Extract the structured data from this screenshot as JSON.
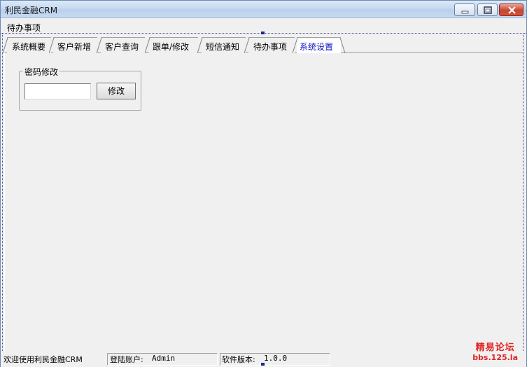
{
  "window": {
    "title": "利民金融CRM"
  },
  "menu": {
    "items": [
      {
        "label": "待办事项"
      }
    ]
  },
  "tabs": [
    {
      "label": "系统概要",
      "active": false
    },
    {
      "label": "客户新增",
      "active": false
    },
    {
      "label": "客户查询",
      "active": false
    },
    {
      "label": "跟单/修改",
      "active": false
    },
    {
      "label": "短信通知",
      "active": false
    },
    {
      "label": "待办事项",
      "active": false
    },
    {
      "label": "系统设置",
      "active": true
    }
  ],
  "password_group": {
    "title": "密码修改",
    "input_value": "",
    "button_label": "修改"
  },
  "status": {
    "welcome": "欢迎使用利民金融CRM",
    "login_label": "登陆账户:",
    "login_value": "Admin",
    "version_label": "软件版本:",
    "version_value": "1.0.0"
  },
  "watermark": {
    "line1": "精易论坛",
    "line2": "bbs.125.la"
  },
  "colors": {
    "active_tab_text": "#1010c8",
    "watermark": "#e02424",
    "title_bar": "#c7daf0"
  }
}
